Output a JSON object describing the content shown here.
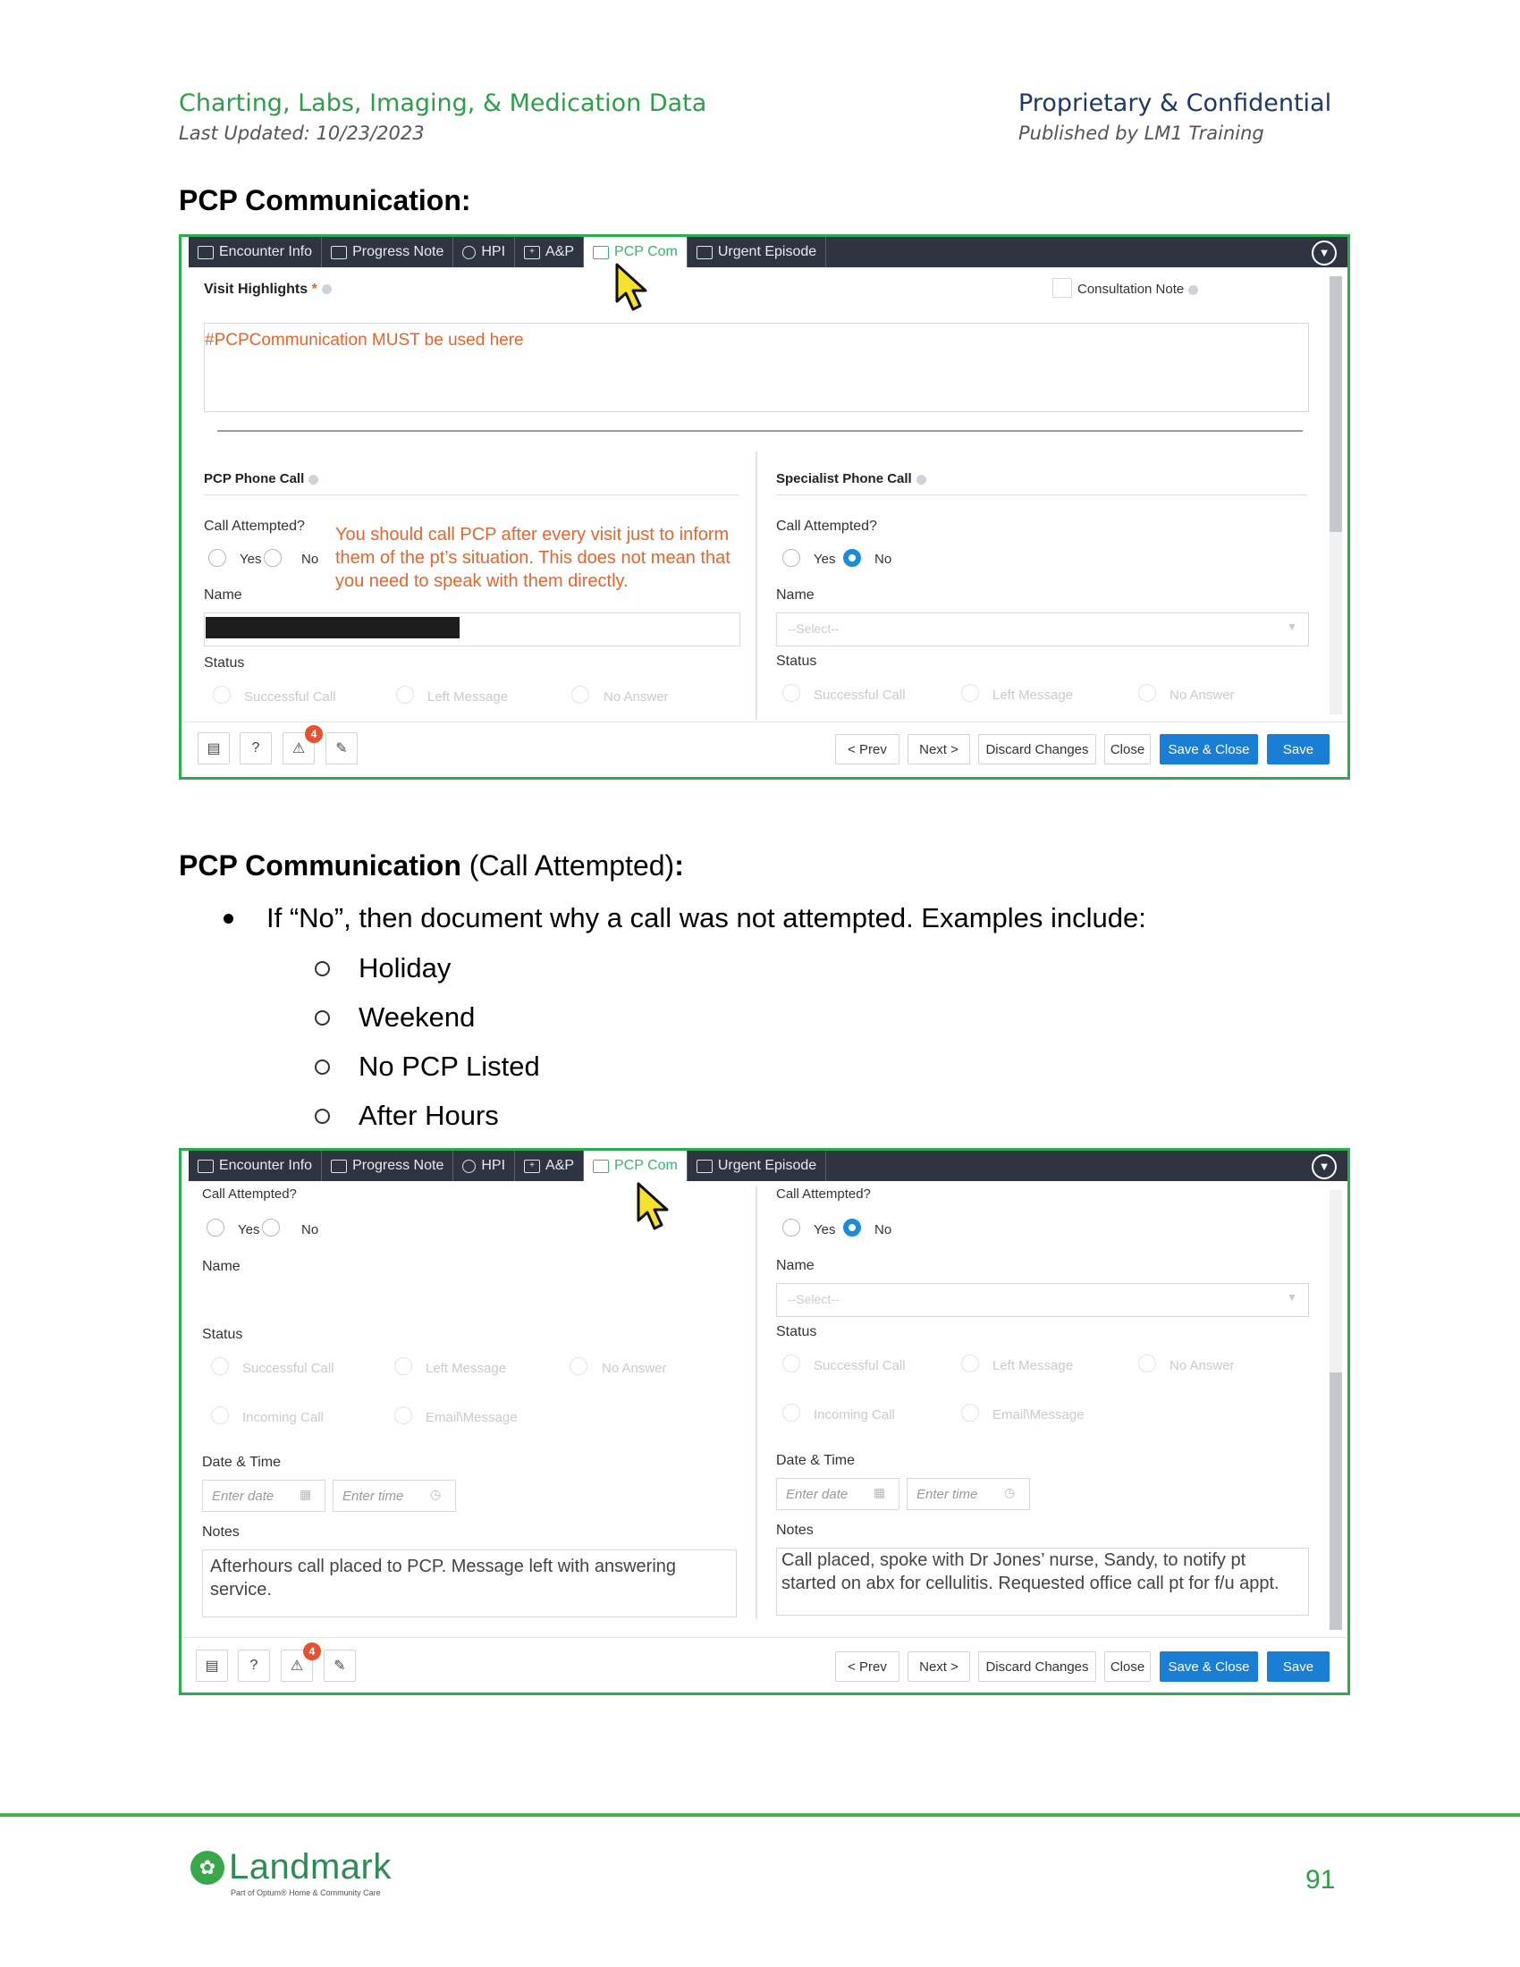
{
  "header": {
    "left_title": "Charting, Labs, Imaging, & Medication Data",
    "left_sub": "Last Updated: 10/23/2023",
    "right_title": "Proprietary & Confidential",
    "right_sub": "Published by LM1 Training"
  },
  "section1": {
    "title": "PCP Communication:"
  },
  "section2": {
    "title_bold": "PCP Communication",
    "title_normal": " (Call Attempted)",
    "title_colon": ":",
    "bullet": "If “No”, then document why a call was not attempted. Examples include:",
    "items": [
      "Holiday",
      "Weekend",
      "No PCP Listed",
      "After Hours"
    ]
  },
  "tabs": [
    "Encounter Info",
    "Progress Note",
    "HPI",
    "A&P",
    "PCP Com",
    "Urgent Episode"
  ],
  "shot1": {
    "visit_highlights": "Visit Highlights",
    "consultation_note": "Consultation Note",
    "highlights_text": "#PCPCommunication MUST be used here",
    "pcp_phone_call": "PCP Phone Call",
    "specialist_phone_call": "Specialist Phone Call",
    "call_attempted": "Call Attempted?",
    "yes": "Yes",
    "no": "No",
    "name": "Name",
    "status": "Status",
    "select_placeholder": "--Select--",
    "status_options": [
      "Successful Call",
      "Left Message",
      "No Answer"
    ],
    "annotation": "You should call PCP after every visit just to inform them of the pt’s situation.  This does not mean that you need to speak with them directly."
  },
  "shot2": {
    "call_attempted": "Call Attempted?",
    "yes": "Yes",
    "no": "No",
    "name": "Name",
    "status": "Status",
    "select_placeholder": "--Select--",
    "status_options": [
      "Successful Call",
      "Left Message",
      "No Answer",
      "Incoming Call",
      "Email\\Message"
    ],
    "date_time": "Date & Time",
    "enter_date": "Enter date",
    "enter_time": "Enter time",
    "notes": "Notes",
    "left_notes": "Afterhours call placed to PCP.  Message left with answering service.",
    "right_notes": "Call placed, spoke with Dr Jones’ nurse, Sandy, to notify pt started on abx for cellulitis.  Requested office call pt for f/u appt."
  },
  "buttons": {
    "prev": "< Prev",
    "next": "Next >",
    "discard": "Discard Changes",
    "close": "Close",
    "save_close": "Save & Close",
    "save": "Save",
    "alert_count": "4"
  },
  "footer": {
    "logo": "Landmark",
    "logo_sub": "Part of Optum® Home & Community Care",
    "page_number": "91"
  }
}
